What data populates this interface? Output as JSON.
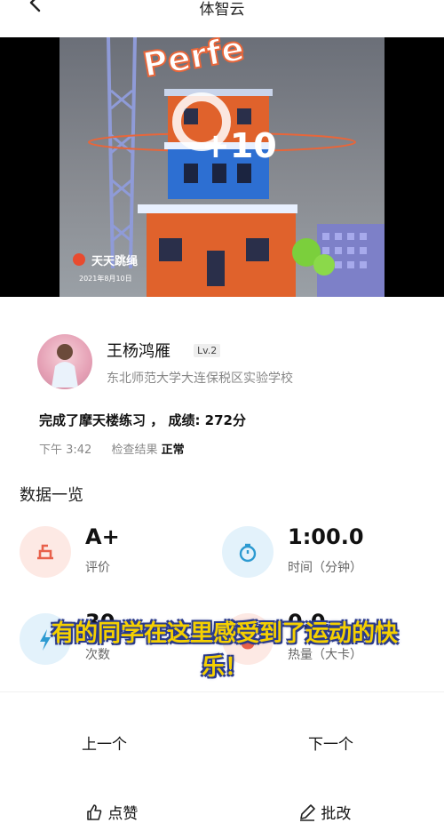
{
  "header": {
    "back_icon": "chevron-left-icon",
    "title": "体智云"
  },
  "video": {
    "brand": "天天跳绳",
    "date_stamp": "2021年8月10日",
    "overlay_text": "Perfe",
    "score_popup": "+10"
  },
  "profile": {
    "name": "王杨鸿雁",
    "level": "Lv.2",
    "school": "东北师范大学大连保税区实验学校"
  },
  "activity": {
    "result": "完成了摩天楼练习 ， 成绩: 272分",
    "time": "下午 3:42",
    "check_label": "检查结果",
    "check_value": "正常"
  },
  "section_title": "数据一览",
  "stats": [
    {
      "value": "A+",
      "label": "评价",
      "icon": "podium-icon",
      "color": "#e8604a"
    },
    {
      "value": "1:00.0",
      "label": "时间（分钟）",
      "icon": "stopwatch-icon",
      "color": "#2c9ad1"
    },
    {
      "value": "30",
      "label": "次数",
      "icon": "lightning-icon",
      "color": "#2c9ad1"
    },
    {
      "value": "0.0",
      "label": "热量（大卡）",
      "icon": "flame-icon",
      "color": "#e8604a"
    }
  ],
  "subtitle": "有的同学在这里感受到了运动的快乐！",
  "nav": {
    "prev": "上一个",
    "next": "下一个"
  },
  "actions": {
    "like": "点赞",
    "review": "批改"
  }
}
